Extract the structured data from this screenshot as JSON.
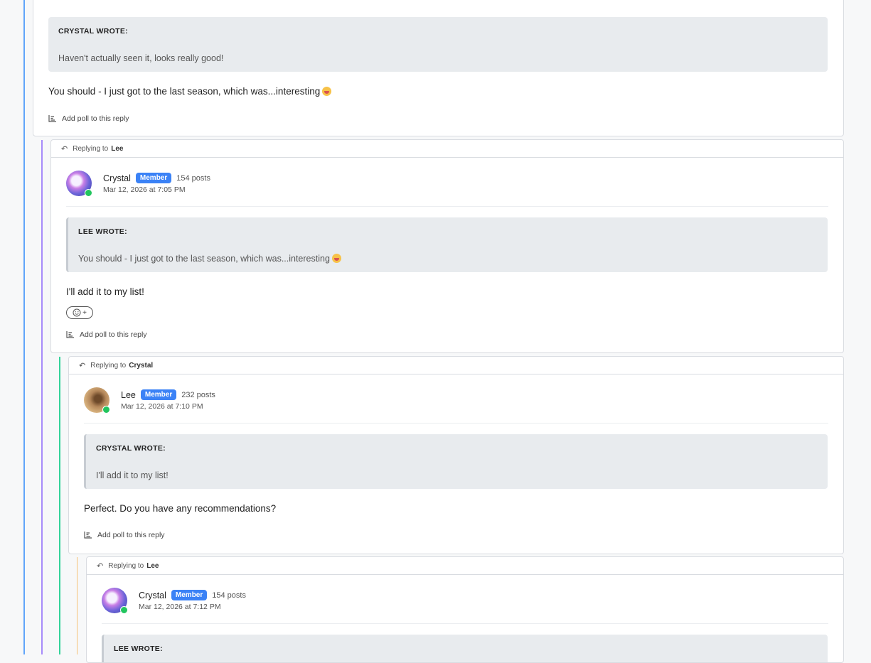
{
  "reply_prefix": "Replying to",
  "posts": [
    {
      "quote_author": "CRYSTAL WROTE:",
      "quote_text": "Haven't actually seen it, looks really good!",
      "body": "You should - I just got to the last season, which was...interesting",
      "poll_label": "Add poll to this reply"
    },
    {
      "replying_to": "Lee",
      "author": "Crystal",
      "badge": "Member",
      "post_count": "154 posts",
      "timestamp": "Mar 12, 2026 at 7:05 PM",
      "quote_author": "LEE WROTE:",
      "quote_text": "You should - I just got to the last season, which was...interesting",
      "body": "I'll add it to my list!",
      "reaction_label": "+",
      "poll_label": "Add poll to this reply"
    },
    {
      "replying_to": "Crystal",
      "author": "Lee",
      "badge": "Member",
      "post_count": "232 posts",
      "timestamp": "Mar 12, 2026 at 7:10 PM",
      "quote_author": "CRYSTAL WROTE:",
      "quote_text": "I'll add it to my list!",
      "body": "Perfect. Do you have any recommendations?",
      "poll_label": "Add poll to this reply"
    },
    {
      "replying_to": "Lee",
      "author": "Crystal",
      "badge": "Member",
      "post_count": "154 posts",
      "timestamp": "Mar 12, 2026 at 7:12 PM",
      "quote_author": "LEE WROTE:"
    }
  ],
  "colors": {
    "thread_line_1": "#60a5fa",
    "thread_line_2": "#a78bfa",
    "thread_line_3": "#34d399",
    "thread_line_4": "#f5c37a",
    "badge": "#3b82f6",
    "online": "#22c55e"
  }
}
